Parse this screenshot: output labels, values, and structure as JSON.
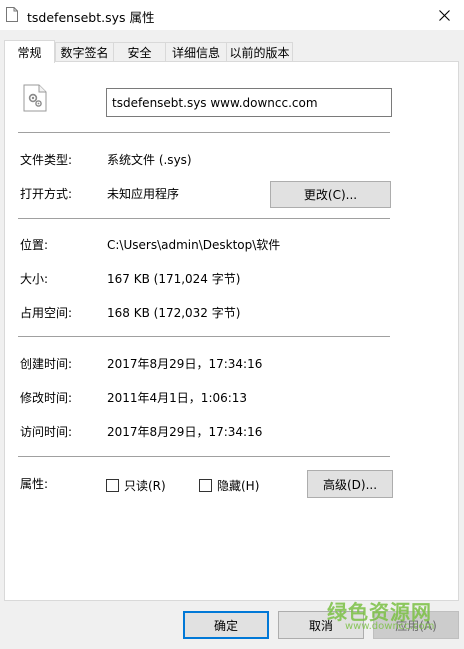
{
  "window": {
    "title": "tsdefensebt.sys 属性"
  },
  "tabs": [
    {
      "label": "常规",
      "active": true
    },
    {
      "label": "数字签名",
      "active": false
    },
    {
      "label": "安全",
      "active": false
    },
    {
      "label": "详细信息",
      "active": false
    },
    {
      "label": "以前的版本",
      "active": false
    }
  ],
  "file": {
    "name": "tsdefensebt.sys  www.downcc.com",
    "icon": "system-file-icon"
  },
  "props": {
    "type_label": "文件类型:",
    "type_value": "系统文件 (.sys)",
    "opens_label": "打开方式:",
    "opens_value": "未知应用程序",
    "change_button": "更改(C)...",
    "location_label": "位置:",
    "location_value": "C:\\Users\\admin\\Desktop\\软件",
    "size_label": "大小:",
    "size_value": "167 KB (171,024 字节)",
    "disk_label": "占用空间:",
    "disk_value": "168 KB (172,032 字节)",
    "created_label": "创建时间:",
    "created_value": "2017年8月29日，17:34:16",
    "modified_label": "修改时间:",
    "modified_value": "2011年4月1日，1:06:13",
    "accessed_label": "访问时间:",
    "accessed_value": "2017年8月29日，17:34:16",
    "attributes_label": "属性:",
    "readonly_label": "只读(R)",
    "readonly_checked": false,
    "hidden_label": "隐藏(H)",
    "hidden_checked": false,
    "advanced_button": "高级(D)..."
  },
  "footer": {
    "ok": "确定",
    "cancel": "取消",
    "apply": "应用(A)"
  },
  "watermark": {
    "text": "绿色资源网",
    "url": "www.downcc.com"
  }
}
